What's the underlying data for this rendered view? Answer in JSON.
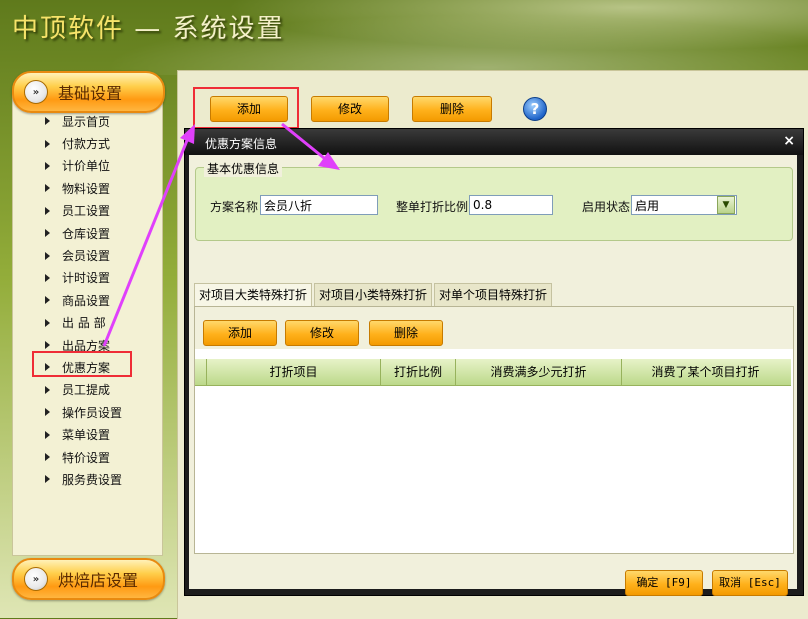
{
  "window": {
    "brand": "中顶软件",
    "separator": " — ",
    "title": "系统设置"
  },
  "sidebar": {
    "category_top": "基础设置",
    "category_bottom": "烘焙店设置",
    "items": [
      {
        "label": "显示首页"
      },
      {
        "label": "付款方式"
      },
      {
        "label": "计价单位"
      },
      {
        "label": "物料设置"
      },
      {
        "label": "员工设置"
      },
      {
        "label": "仓库设置"
      },
      {
        "label": "会员设置"
      },
      {
        "label": "计时设置"
      },
      {
        "label": "商品设置"
      },
      {
        "label": "出 品 部"
      },
      {
        "label": "出品方案"
      },
      {
        "label": "优惠方案"
      },
      {
        "label": "员工提成"
      },
      {
        "label": "操作员设置"
      },
      {
        "label": "菜单设置"
      },
      {
        "label": "特价设置"
      },
      {
        "label": "服务费设置"
      }
    ]
  },
  "toolbar": {
    "add": "添加",
    "edit": "修改",
    "delete": "删除",
    "help_icon": "question-icon"
  },
  "dialog": {
    "title": "优惠方案信息",
    "close": "×",
    "basic_group": "基本优惠信息",
    "scheme_name_label": "方案名称",
    "scheme_name_value": "会员八折",
    "discount_label": "整单打折比例",
    "discount_value": "0.8",
    "status_label": "启用状态",
    "status_value": "启用",
    "tabs": [
      "对项目大类特殊打折",
      "对项目小类特殊打折",
      "对单个项目特殊打折"
    ],
    "tab_buttons": {
      "add": "添加",
      "edit": "修改",
      "delete": "删除"
    },
    "columns": [
      "",
      "打折项目",
      "打折比例",
      "消费满多少元打折",
      "消费了某个项目打折"
    ],
    "ok": "确定 [F9]",
    "cancel": "取消 [Esc]"
  },
  "colors": {
    "accent": "#ffb11b",
    "highlight": "#ef2d36",
    "arrow": "#e040fb"
  }
}
